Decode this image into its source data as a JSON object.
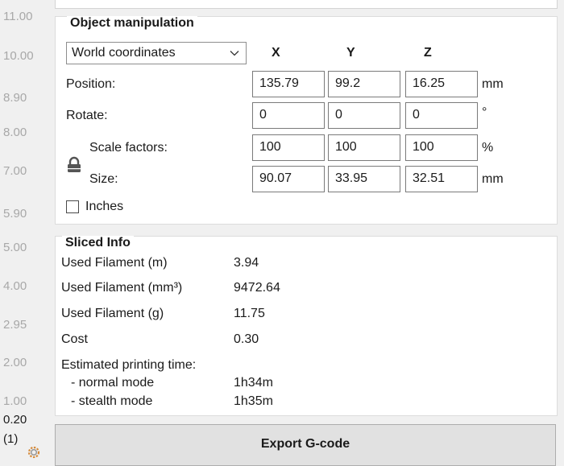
{
  "ruler": {
    "ticks": [
      "11.00",
      "10.00",
      "8.90",
      "8.00",
      "7.00",
      "5.90",
      "5.00",
      "4.00",
      "2.95",
      "2.00",
      "1.00"
    ],
    "current_value": "0.20",
    "current_layer": "(1)"
  },
  "object_manipulation": {
    "title": "Object manipulation",
    "coordinate_system": "World coordinates",
    "axes": {
      "x": "X",
      "y": "Y",
      "z": "Z"
    },
    "position": {
      "label": "Position:",
      "x": "135.79",
      "y": "99.2",
      "z": "16.25",
      "unit": "mm"
    },
    "rotate": {
      "label": "Rotate:",
      "x": "0",
      "y": "0",
      "z": "0",
      "unit": "°"
    },
    "scale": {
      "label": "Scale factors:",
      "x": "100",
      "y": "100",
      "z": "100",
      "unit": "%"
    },
    "size": {
      "label": "Size:",
      "x": "90.07",
      "y": "33.95",
      "z": "32.51",
      "unit": "mm"
    },
    "inches": {
      "label": "Inches",
      "checked": false
    }
  },
  "sliced_info": {
    "title": "Sliced Info",
    "used_filament_m": {
      "label": "Used Filament (m)",
      "value": "3.94"
    },
    "used_filament_mm3": {
      "label": "Used Filament (mm³)",
      "value": "9472.64"
    },
    "used_filament_g": {
      "label": "Used Filament (g)",
      "value": "11.75"
    },
    "cost": {
      "label": "Cost",
      "value": "0.30"
    },
    "estimated_time": {
      "label": "Estimated printing time:"
    },
    "normal_mode": {
      "label": "- normal mode",
      "value": "1h34m"
    },
    "stealth_mode": {
      "label": "- stealth mode",
      "value": "1h35m"
    }
  },
  "export_button": {
    "label": "Export G-code"
  },
  "icons": {
    "lock": "lock-icon",
    "gear": "gear-icon",
    "chevron": "chevron-down-icon"
  }
}
